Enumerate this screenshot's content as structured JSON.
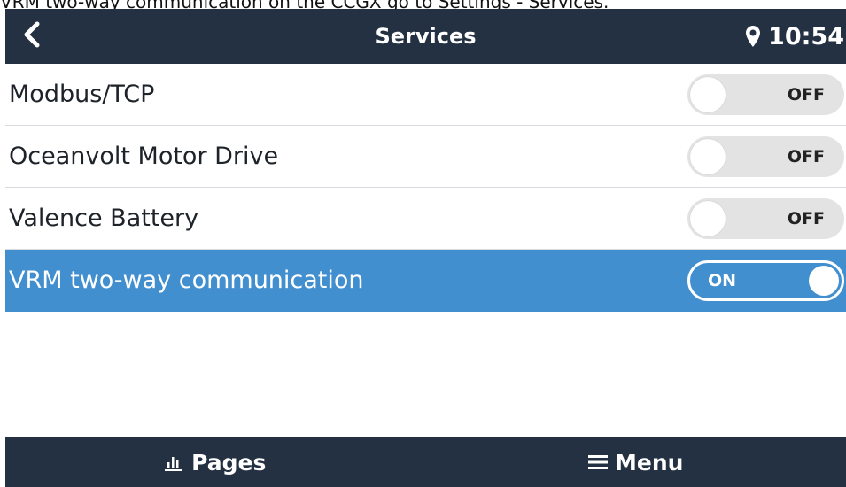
{
  "caption": "VRM two-way communication on the CCGX go to Settings - Services.",
  "header": {
    "title": "Services",
    "back_icon": "chevron-left-icon",
    "location_icon": "location-pin-icon",
    "time": "10:54",
    "background": "#233142"
  },
  "services": [
    {
      "label": "Modbus/TCP",
      "state": "OFF",
      "enabled": false
    },
    {
      "label": "Oceanvolt Motor Drive",
      "state": "OFF",
      "enabled": false
    },
    {
      "label": "Valence Battery",
      "state": "OFF",
      "enabled": false
    },
    {
      "label": "VRM two-way communication",
      "state": "ON",
      "enabled": true,
      "selected": true
    }
  ],
  "footer": {
    "pages_label": "Pages",
    "pages_icon": "bar-chart-icon",
    "menu_label": "Menu",
    "menu_icon": "hamburger-menu-icon"
  },
  "colors": {
    "accent": "#428fd0",
    "toggle_off": "#e3e3e3",
    "bar": "#233142"
  }
}
